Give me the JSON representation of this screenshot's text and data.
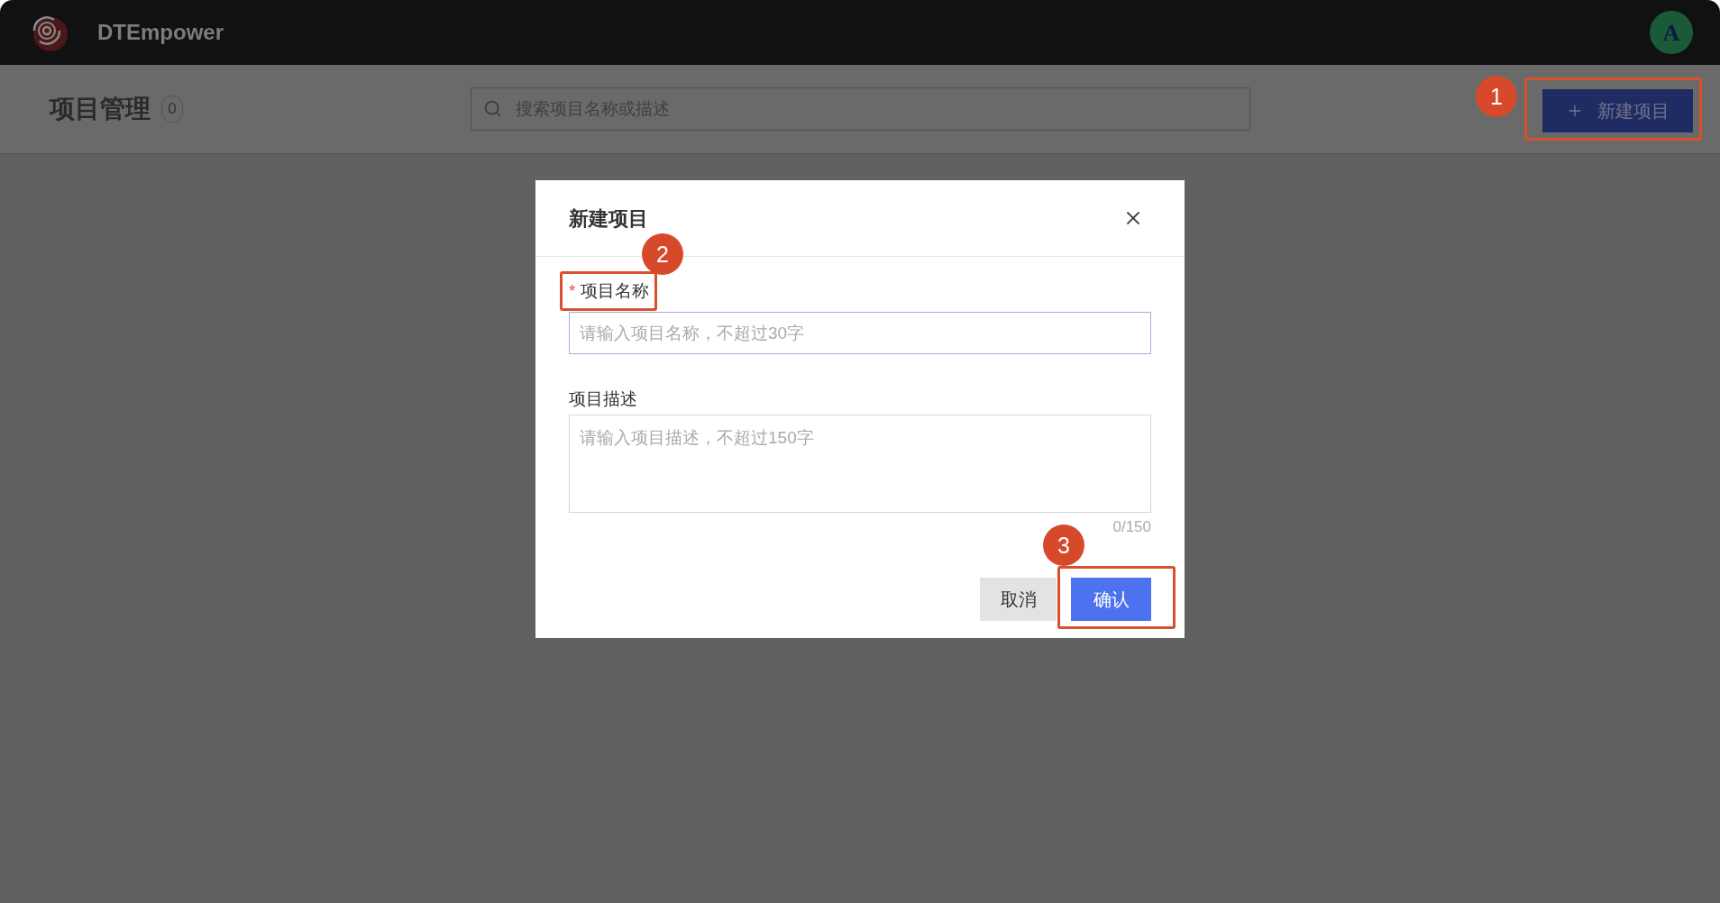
{
  "app": {
    "name": "DTEmpower"
  },
  "user": {
    "initial": "A"
  },
  "page": {
    "title": "项目管理",
    "count": "0",
    "search": {
      "placeholder": "搜索项目名称或描述"
    },
    "new_button": {
      "label": "新建项目",
      "callout": "1"
    }
  },
  "dialog": {
    "title": "新建项目",
    "fields": [
      {
        "kind": "input",
        "label": "项目名称",
        "required_mark": "*",
        "focused": true,
        "placeholder": "请输入项目名称，不超过30字",
        "callout": "2"
      },
      {
        "kind": "textarea",
        "label": "项目描述",
        "focused": false,
        "placeholder": "请输入项目描述，不超过150字",
        "counter": "0/150"
      }
    ],
    "buttons": [
      {
        "kind": "secondary",
        "label": "取消"
      },
      {
        "kind": "primary",
        "label": "确认",
        "callout": "3"
      }
    ]
  }
}
